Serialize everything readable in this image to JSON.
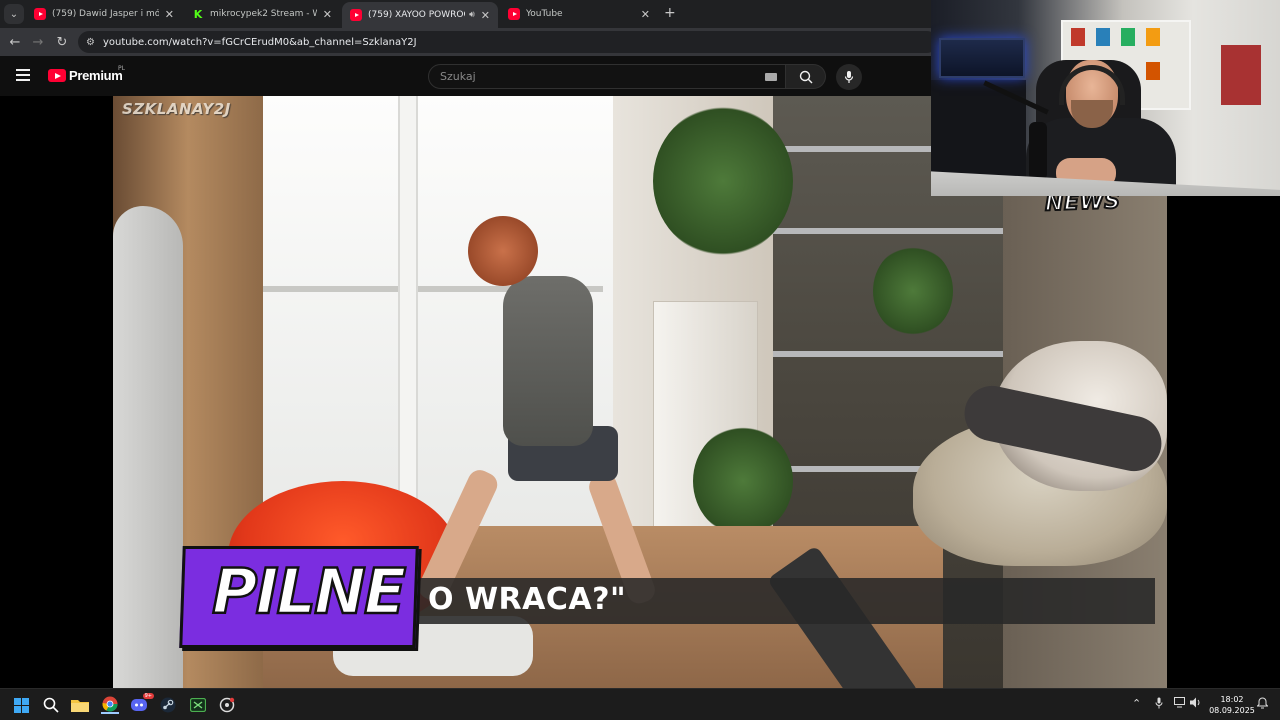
{
  "browser": {
    "tabs": [
      {
        "title": "(759) Dawid Jasper i mój zajebi",
        "favicon": "youtube-icon"
      },
      {
        "title": "mikrocypek2 Stream - Watch Li",
        "favicon": "kick-icon"
      },
      {
        "title": "(759) XAYOO POWRÓCI? JA",
        "favicon": "youtube-icon",
        "active": true,
        "audio": true
      },
      {
        "title": "YouTube",
        "favicon": "youtube-icon"
      }
    ],
    "url": "youtube.com/watch?v=fGCrCErudM0&ab_channel=SzklanaY2J"
  },
  "youtube": {
    "brand": "Premium",
    "region": "PL",
    "search_placeholder": "Szukaj"
  },
  "video": {
    "watermark": "SZKLANAY2J",
    "corner_tag": "NEWS",
    "badge": "PILNE",
    "caption": "O WRACA?\""
  },
  "taskbar": {
    "discord_badge": "9+",
    "time": "18:02",
    "date": "08.09.2025"
  },
  "colors": {
    "youtube_red": "#ff0033",
    "kick_green": "#53fc18",
    "pilne_purple": "#7b2de0",
    "windows_blue": "#3fa9f5"
  }
}
